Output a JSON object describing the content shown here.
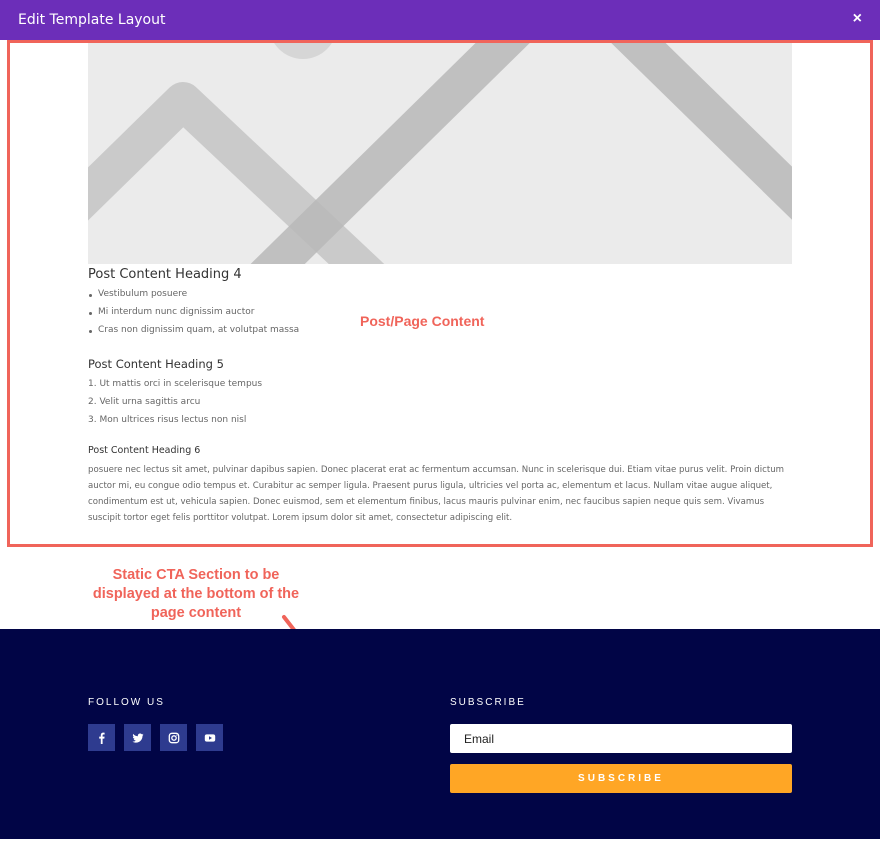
{
  "modal": {
    "title": "Edit Template Layout",
    "close_label": "×"
  },
  "post": {
    "heading4": "Post Content Heading 4",
    "bullets": [
      "Vestibulum posuere",
      "Mi interdum nunc dignissim auctor",
      "Cras non dignissim quam, at volutpat massa"
    ],
    "heading5": "Post Content Heading 5",
    "numbered": [
      "1. Ut mattis orci in scelerisque tempus",
      "2. Velit urna sagittis arcu",
      "3. Mon ultrices risus lectus non nisl"
    ],
    "heading6": "Post Content Heading 6",
    "paragraph": "posuere nec lectus sit amet, pulvinar dapibus sapien. Donec placerat erat ac fermentum accumsan. Nunc in scelerisque dui. Etiam vitae purus velit. Proin dictum auctor mi, eu congue odio tempus et. Curabitur ac semper ligula. Praesent purus ligula, ultricies vel porta ac, elementum et lacus. Nullam vitae augue aliquet, condimentum est ut, vehicula sapien. Donec euismod, sem et elementum finibus, lacus mauris pulvinar enim, nec faucibus sapien neque quis sem. Vivamus suscipit tortor eget felis porttitor volutpat. Lorem ipsum dolor sit amet, consectetur adipiscing elit."
  },
  "annotations": {
    "content_label": "Post/Page Content",
    "cta_note": "Static CTA Section to be displayed at the bottom of the page content"
  },
  "footer": {
    "follow_title": "FOLLOW US",
    "social_icons": [
      "facebook-icon",
      "twitter-icon",
      "instagram-icon",
      "youtube-icon"
    ],
    "subscribe_title": "SUBSCRIBE",
    "email_placeholder": "Email",
    "subscribe_button": "SUBSCRIBE"
  },
  "colors": {
    "modal_bar": "#6c2eb9",
    "annotation": "#f0645a",
    "footer_bg": "#010546",
    "social_bg": "#2e3b8f",
    "subscribe_btn": "#ffa625"
  }
}
